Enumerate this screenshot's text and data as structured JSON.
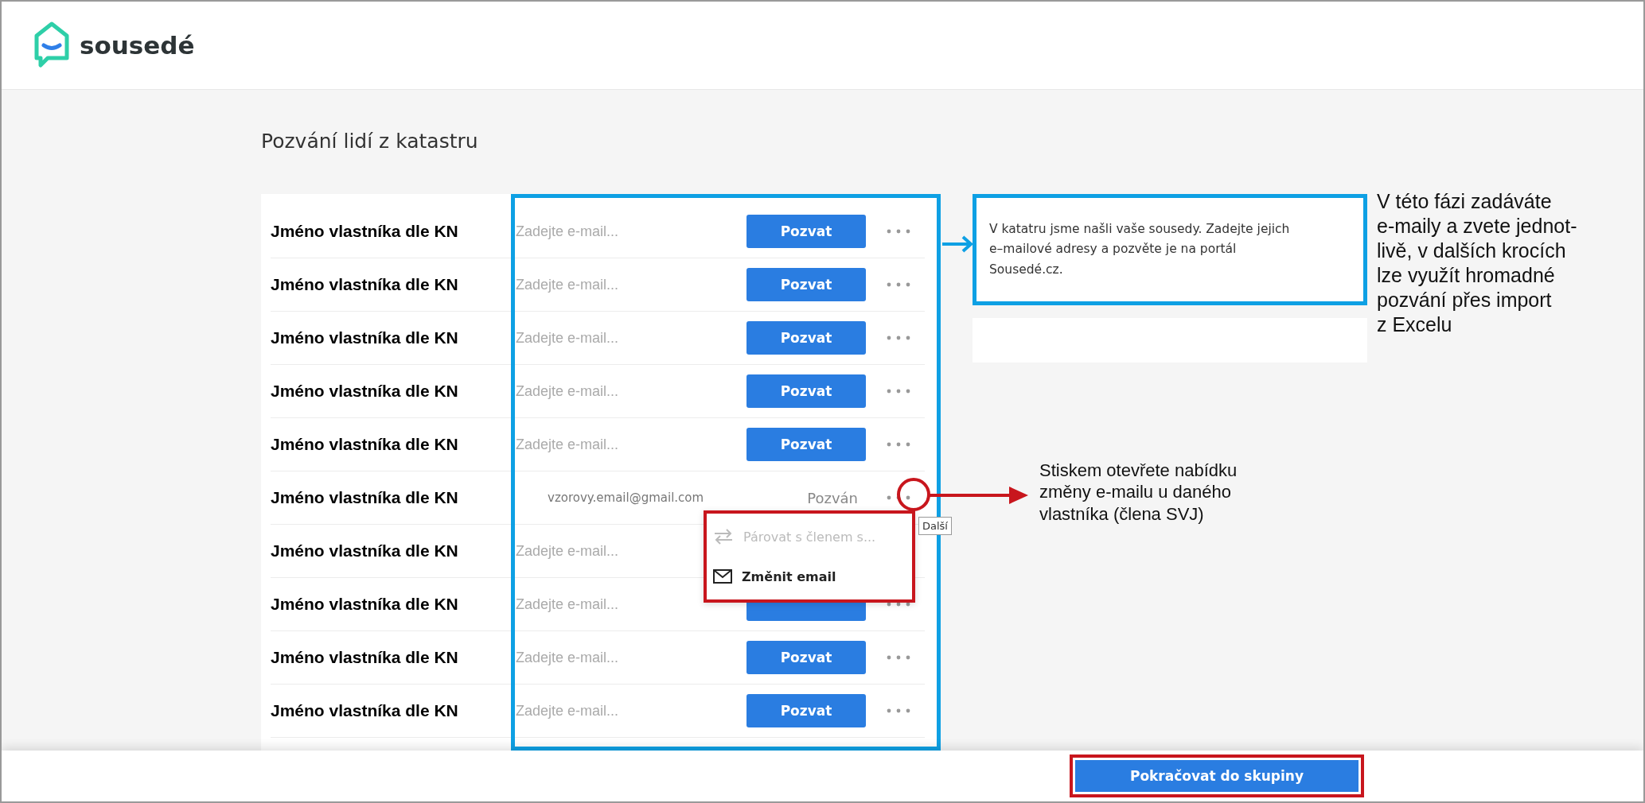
{
  "header": {
    "logo_text": "sousedé"
  },
  "page": {
    "title": "Pozvání lidí z katastru"
  },
  "rows": [
    {
      "kind": "open",
      "name": "Jméno vlastníka dle KN",
      "placeholder": "Zadejte e-mail...",
      "button": "Pozvat"
    },
    {
      "kind": "open",
      "name": "Jméno vlastníka dle KN",
      "placeholder": "Zadejte e-mail...",
      "button": "Pozvat"
    },
    {
      "kind": "open",
      "name": "Jméno vlastníka dle KN",
      "placeholder": "Zadejte e-mail...",
      "button": "Pozvat"
    },
    {
      "kind": "open",
      "name": "Jméno vlastníka dle KN",
      "placeholder": "Zadejte e-mail...",
      "button": "Pozvat"
    },
    {
      "kind": "open",
      "name": "Jméno vlastníka dle KN",
      "placeholder": "Zadejte e-mail...",
      "button": "Pozvat"
    },
    {
      "kind": "invited",
      "name": "Jméno vlastníka dle KN",
      "email": "vzorovy.email@gmail.com",
      "status": "Pozván"
    },
    {
      "kind": "open",
      "name": "Jméno vlastníka dle KN",
      "placeholder": "Zadejte e-mail..."
    },
    {
      "kind": "open",
      "name": "Jméno vlastníka dle KN",
      "placeholder": "Zadejte e-mail..."
    },
    {
      "kind": "open",
      "name": "Jméno vlastníka dle KN",
      "placeholder": "Zadejte e-mail...",
      "button": "Pozvat"
    },
    {
      "kind": "open",
      "name": "Jméno vlastníka dle KN",
      "placeholder": "Zadejte e-mail...",
      "button": "Pozvat"
    }
  ],
  "row_menu": {
    "tooltip": "Další",
    "items": [
      {
        "kind": "pair",
        "label": "Párovat s členem s...",
        "disabled": true
      },
      {
        "kind": "mail",
        "label": "Změnit email",
        "disabled": false
      }
    ]
  },
  "info_box": {
    "lines": [
      "V katatru jsme našli vaše sousedy. Zadejte jejich",
      "e–mailové adresy a pozvěte je na portál",
      "Sousedé.cz."
    ]
  },
  "footer": {
    "button": "Pokračovat do skupiny"
  },
  "annotations": [
    {
      "kind": "blue",
      "lines": [
        "V této fázi zadáváte",
        "e-maily a zvete jednot-",
        "livě, v dalších krocích",
        "lze využít hromadné",
        "pozvání přes import",
        "z Excelu"
      ]
    },
    {
      "kind": "red",
      "lines": [
        "Stiskem otevřete nabídku",
        "změny e-mailu u daného",
        "vlastníka (člena SVJ)"
      ]
    }
  ]
}
